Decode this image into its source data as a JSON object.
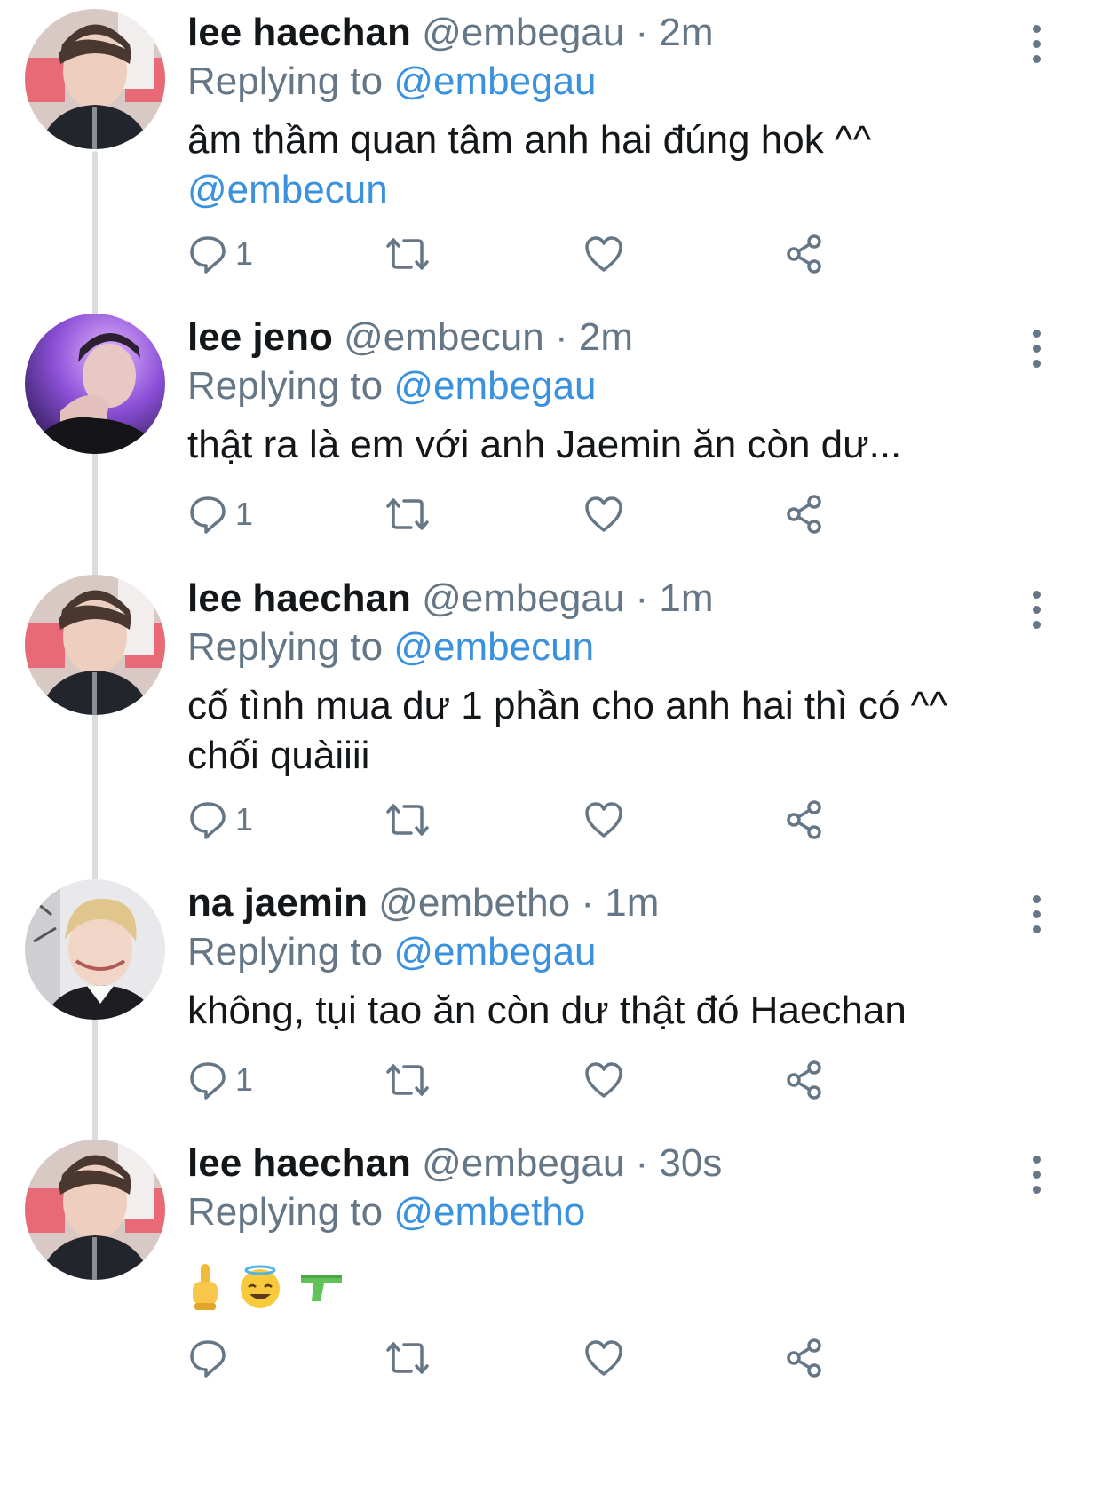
{
  "tweets": [
    {
      "display_name": "lee haechan",
      "handle": "@embegau",
      "dot": "·",
      "time": "2m",
      "replying_prefix": "Replying to",
      "replying_to": "@embegau",
      "text": "âm thầm quan tâm anh hai đúng hok ^^",
      "mention": "@embecun",
      "reply_count": "1",
      "avatar": "haechan-avatar"
    },
    {
      "display_name": "lee jeno",
      "handle": "@embecun",
      "dot": "·",
      "time": "2m",
      "replying_prefix": "Replying to",
      "replying_to": "@embegau",
      "text": "thật ra là em với anh Jaemin ăn còn dư...",
      "reply_count": "1",
      "avatar": "jeno-avatar"
    },
    {
      "display_name": "lee haechan",
      "handle": "@embegau",
      "dot": "·",
      "time": "1m",
      "replying_prefix": "Replying to",
      "replying_to": "@embecun",
      "text": "cố tình mua dư 1 phần cho anh hai thì có ^^",
      "text_line2": "chối quàiiii",
      "reply_count": "1",
      "avatar": "haechan-avatar"
    },
    {
      "display_name": "na jaemin",
      "handle": "@embetho",
      "dot": "·",
      "time": "1m",
      "replying_prefix": "Replying to",
      "replying_to": "@embegau",
      "text": "không, tụi tao ăn còn dư thật đó Haechan",
      "reply_count": "1",
      "avatar": "jaemin-avatar"
    },
    {
      "display_name": "lee haechan",
      "handle": "@embegau",
      "dot": "·",
      "time": "30s",
      "replying_prefix": "Replying to",
      "replying_to": "@embetho",
      "emojis": [
        "middle-finger-emoji",
        "halo-smile-emoji",
        "water-pistol-emoji"
      ],
      "reply_count": "",
      "avatar": "haechan-avatar"
    }
  ],
  "colors": {
    "text": "#14171a",
    "secondary": "#657786",
    "link": "#3a91dd",
    "thread_line": "#d9dde1"
  },
  "icons": [
    "reply-icon",
    "retweet-icon",
    "like-icon",
    "share-icon",
    "more-icon"
  ]
}
